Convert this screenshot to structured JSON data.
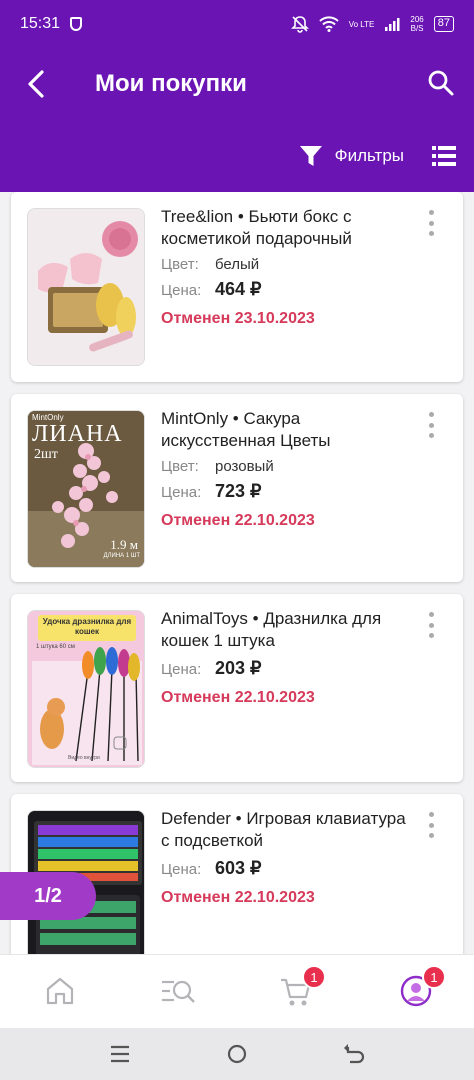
{
  "status_bar": {
    "time": "15:31",
    "network_speed": "206",
    "network_unit": "B/S",
    "battery": "87",
    "lte_label": "Vo LTE"
  },
  "header": {
    "title": "Мои покупки",
    "filter_label": "Фильтры"
  },
  "products": [
    {
      "name": "Tree&lion • Бьюти бокс с косметикой подарочный",
      "color_label": "Цвет:",
      "color": "белый",
      "price_label": "Цена:",
      "price": "464 ₽",
      "status": "Отменен 23.10.2023",
      "thumb_text": ""
    },
    {
      "name": "MintOnly • Сакура искусственная Цветы",
      "color_label": "Цвет:",
      "color": "розовый",
      "price_label": "Цена:",
      "price": "723 ₽",
      "status": "Отменен 22.10.2023",
      "thumb_brand": "MintOnly",
      "thumb_title": "ЛИАНА",
      "thumb_sub": "2шт",
      "thumb_size": "1.9 м",
      "thumb_size_sub": "ДЛИНА 1 ШТ"
    },
    {
      "name": "AnimalToys • Дразнилка для кошек 1 штука",
      "price_label": "Цена:",
      "price": "203 ₽",
      "status": "Отменен 22.10.2023",
      "thumb_title": "Удочка дразнилка для кошек",
      "thumb_sub": "1 штука 60 см",
      "thumb_note": "Видео внутри"
    },
    {
      "name": "Defender • Игровая клавиатура с подсветкой",
      "price_label": "Цена:",
      "price": "603 ₽",
      "status": "Отменен 22.10.2023"
    }
  ],
  "pager": {
    "text": "1/2"
  },
  "bottom_nav": {
    "cart_badge": "1",
    "profile_badge": "1"
  },
  "colors": {
    "brand": "#6a14b4",
    "status_cancelled": "#d63a5a",
    "badge": "#e8304e",
    "pager": "#a23ac8"
  }
}
